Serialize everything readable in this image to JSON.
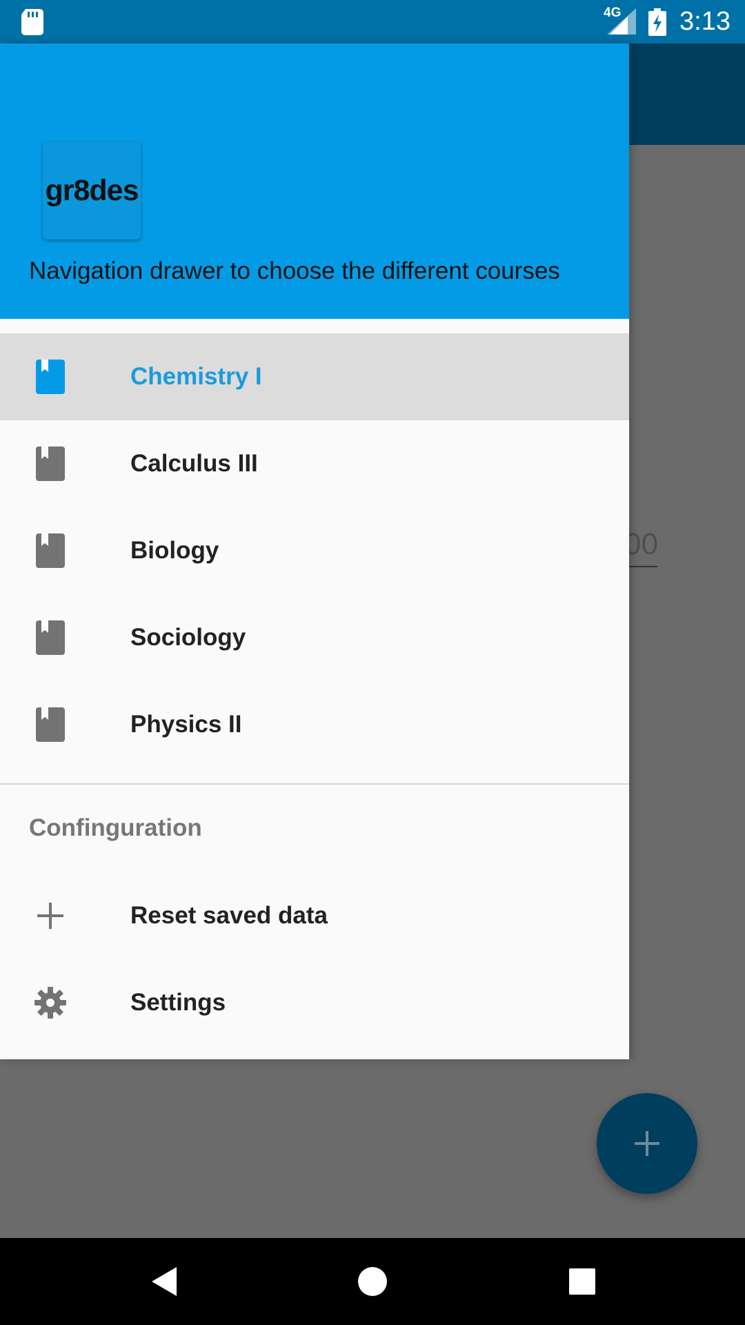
{
  "status_bar": {
    "time": "3:13",
    "network": "4G"
  },
  "background": {
    "field_fragment": "00"
  },
  "drawer": {
    "logo_text": "gr8des",
    "subtitle": "Navigation drawer to choose the different courses",
    "courses": [
      {
        "label": "Chemistry I",
        "icon": "book-icon",
        "selected": true
      },
      {
        "label": "Calculus III",
        "icon": "book-icon",
        "selected": false
      },
      {
        "label": "Biology",
        "icon": "book-icon",
        "selected": false
      },
      {
        "label": "Sociology",
        "icon": "book-icon",
        "selected": false
      },
      {
        "label": "Physics II",
        "icon": "book-icon",
        "selected": false
      }
    ],
    "section_title": "Confinguration",
    "config_items": [
      {
        "label": "Reset saved data",
        "icon": "plus-icon"
      },
      {
        "label": "Settings",
        "icon": "gear-icon"
      }
    ]
  },
  "colors": {
    "accent": "#039be5",
    "selected_text": "#1a9bdc",
    "appbar_dim": "#003e5e"
  }
}
